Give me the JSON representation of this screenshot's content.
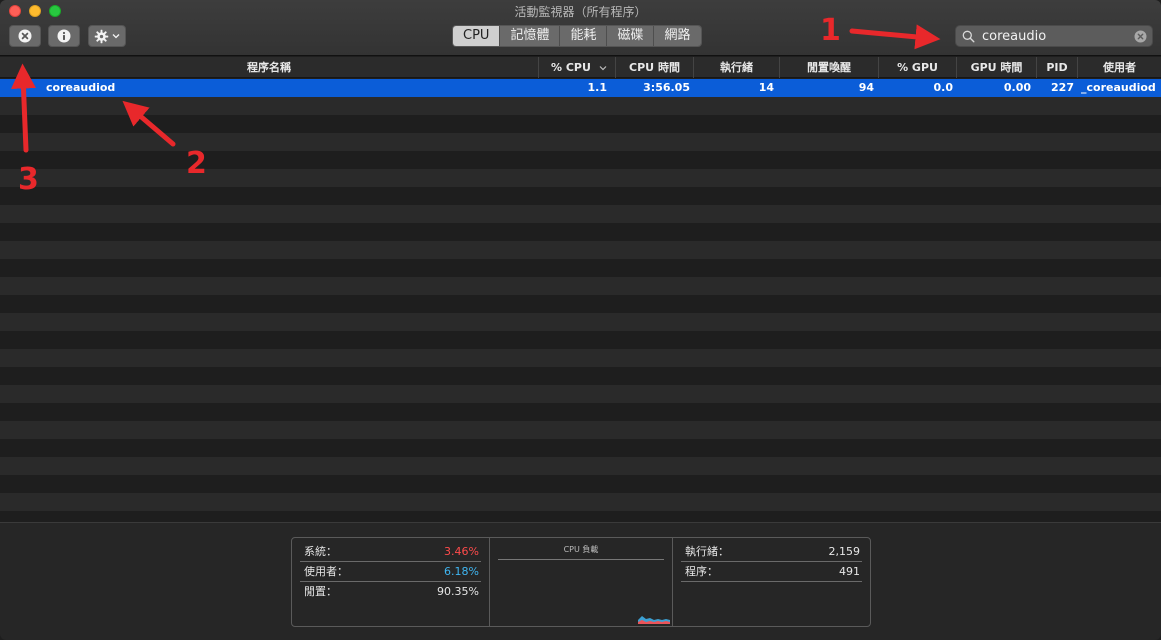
{
  "window": {
    "title": "活動監視器（所有程序）"
  },
  "toolbar": {
    "tabs": [
      {
        "label": "CPU",
        "active": true
      },
      {
        "label": "記憶體",
        "active": false
      },
      {
        "label": "能耗",
        "active": false
      },
      {
        "label": "磁碟",
        "active": false
      },
      {
        "label": "網路",
        "active": false
      }
    ],
    "buttons": [
      {
        "name": "stop-process-button",
        "icon": "stop-x-icon"
      },
      {
        "name": "inspect-process-button",
        "icon": "info-icon"
      },
      {
        "name": "action-menu-button",
        "icon": "gear-icon"
      }
    ],
    "search": {
      "value": "coreaudio",
      "icon": "search-icon",
      "clear_icon": "clear-icon"
    }
  },
  "table": {
    "columns": [
      "程序名稱",
      "% CPU",
      "CPU 時間",
      "執行緒",
      "閒置喚醒",
      "% GPU",
      "GPU 時間",
      "PID",
      "使用者"
    ],
    "sort_indicator": "chevron-down-icon",
    "rows": [
      {
        "name": "coreaudiod",
        "cpu": "1.1",
        "cpu_time": "3:56.05",
        "threads": "14",
        "idle_wake": "94",
        "gpu": "0.0",
        "gpu_time": "0.00",
        "pid": "227",
        "user": "_coreaudiod",
        "selected": true
      }
    ]
  },
  "stats": {
    "left": [
      {
        "label": "系統：",
        "value": "3.46%",
        "color": "#ff4b4b"
      },
      {
        "label": "使用者：",
        "value": "6.18%",
        "color": "#3fb6f2"
      },
      {
        "label": "閒置：",
        "value": "90.35%",
        "color": "#e6e6e6"
      }
    ],
    "middle": {
      "title": "CPU 負載"
    },
    "right": [
      {
        "label": "執行緒：",
        "value": "2,159"
      },
      {
        "label": "程序：",
        "value": "491"
      }
    ]
  },
  "annotations": [
    {
      "label": "1"
    },
    {
      "label": "2"
    },
    {
      "label": "3"
    }
  ],
  "colors": {
    "selection": "#0b5dd8",
    "annotation": "#e8282b",
    "system": "#ff4b4b",
    "user": "#3fb6f2"
  }
}
